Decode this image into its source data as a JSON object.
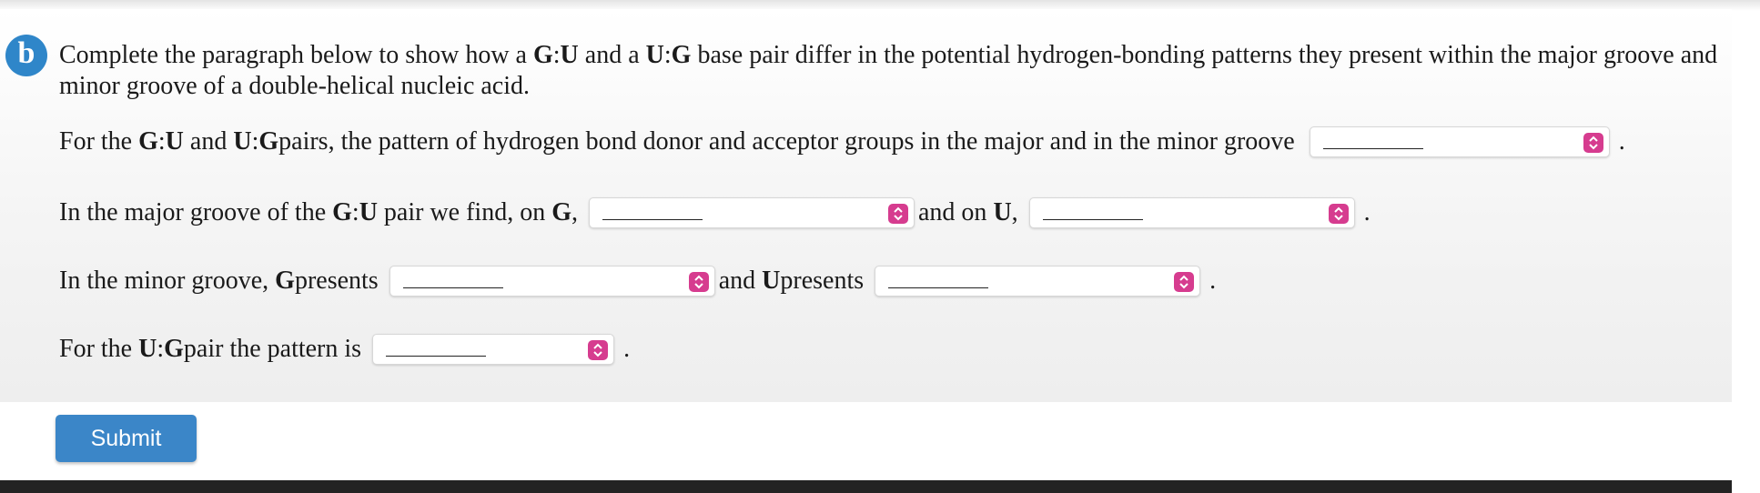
{
  "section_badge": "b",
  "question": {
    "p1": "Complete the paragraph below to show how a ",
    "b1": "G",
    "p2": ":",
    "b2": "U",
    "p3": " and a ",
    "b3": "U",
    "p4": ":",
    "b4": "G",
    "p5": " base pair differ in the potential hydrogen-bonding patterns they present within the major groove and minor groove of a double-helical nucleic acid."
  },
  "line1": {
    "t1": "For the ",
    "b1": "G",
    "t2": ":",
    "b2": "U",
    "t3": " and ",
    "b3": "U",
    "t4": ":",
    "b4": "G",
    "t5": " pairs, the pattern of hydrogen bond donor and acceptor groups in the major and in the minor groove",
    "end": "."
  },
  "line2": {
    "t1": "In the major groove of the ",
    "b1": "G",
    "t2": ":",
    "b2": "U",
    "t3": " pair we find, on ",
    "b3": "G",
    "t4": ",",
    "t5": "and on ",
    "b4": "U",
    "t6": ",",
    "end": "."
  },
  "line3": {
    "t1": "In the minor groove, ",
    "b1": "G",
    "t2": " presents",
    "t3": "and ",
    "b2": "U",
    "t4": " presents",
    "end": "."
  },
  "line4": {
    "t1": "For the ",
    "b1": "U",
    "t2": ":",
    "b2": "G",
    "t3": " pair the pattern is",
    "end": "."
  },
  "dropdowns": {
    "pattern_value": "",
    "major_g_value": "",
    "major_u_value": "",
    "minor_g_value": "",
    "minor_u_value": "",
    "ug_pattern_value": ""
  },
  "submit_label": "Submit",
  "colors": {
    "badge": "#2f86c9",
    "select_chevron": "#d63c8f",
    "submit_button": "#3b86c8",
    "footer_bar": "#232323"
  },
  "icons": {
    "select_chevron": "chevron-up-down-icon"
  }
}
